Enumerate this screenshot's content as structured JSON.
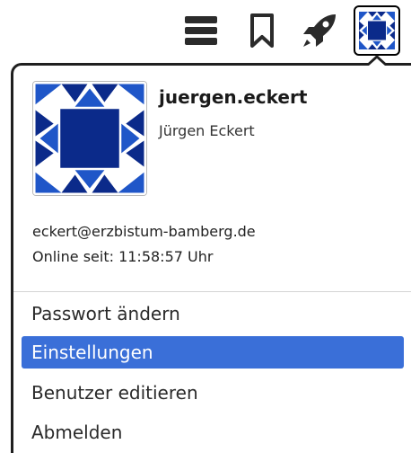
{
  "toolbar": {
    "menu_icon": "hamburger-menu-icon",
    "bookmark_icon": "bookmark-icon",
    "rocket_icon": "rocket-icon",
    "avatar_icon": "user-avatar-icon"
  },
  "profile": {
    "username": "juergen.eckert",
    "full_name": "Jürgen Eckert",
    "email": "eckert@erzbistum-bamberg.de",
    "online_since": "Online seit: 11:58:57 Uhr"
  },
  "menu": {
    "items": [
      {
        "label": "Passwort ändern"
      },
      {
        "label": "Einstellungen",
        "highlighted": true
      },
      {
        "label": "Benutzer editieren"
      },
      {
        "label": "Abmelden"
      }
    ]
  },
  "colors": {
    "highlight": "#3a6fd8",
    "avatar_navy": "#0b2a8a",
    "avatar_blue": "#1f56c8"
  }
}
